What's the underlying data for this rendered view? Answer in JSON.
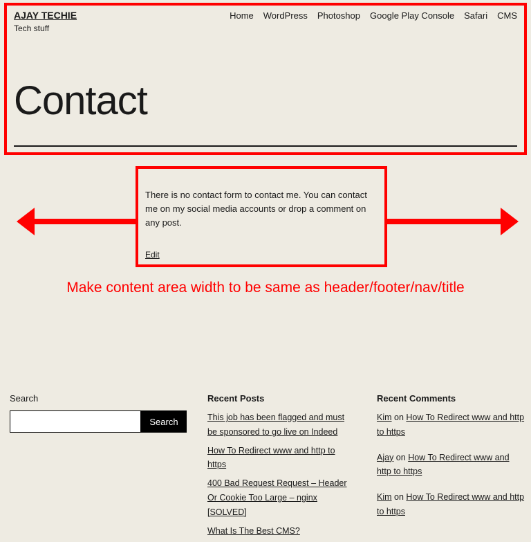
{
  "site": {
    "title": "AJAY TECHIE",
    "tagline": "Tech stuff"
  },
  "nav": {
    "items": [
      "Home",
      "WordPress",
      "Photoshop",
      "Google Play Console",
      "Safari",
      "CMS"
    ]
  },
  "page": {
    "title": "Contact",
    "body": "There is no contact form to contact me. You can contact me on my social media accounts or drop a comment on any post.",
    "edit": "Edit"
  },
  "annotation": {
    "text": "Make content area width to be same as header/footer/nav/title"
  },
  "footer": {
    "search_label": "Search",
    "search_button": "Search",
    "recent_posts_heading": "Recent Posts",
    "recent_posts": [
      "This job has been flagged and must be sponsored to go live on Indeed",
      "How To Redirect www and http to https",
      "400 Bad Request Request – Header Or Cookie Too Large – nginx [SOLVED]",
      "What Is The Best CMS?"
    ],
    "recent_comments_heading": "Recent Comments",
    "recent_comments": [
      {
        "author": "Kim",
        "on": " on ",
        "post": "How To Redirect www and http to https"
      },
      {
        "author": "Ajay",
        "on": " on ",
        "post": "How To Redirect www and http to https"
      },
      {
        "author": "Kim",
        "on": " on ",
        "post": "How To Redirect www and http to https"
      }
    ]
  }
}
